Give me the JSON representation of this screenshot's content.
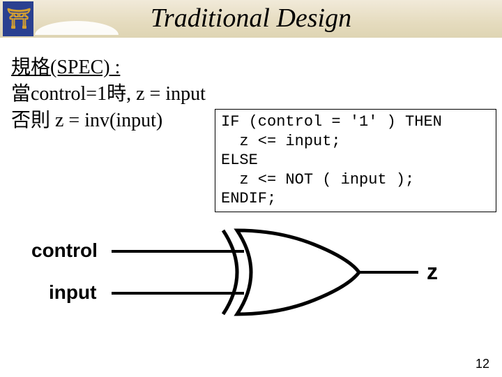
{
  "header": {
    "title": "Traditional Design"
  },
  "spec": {
    "heading": "規格(SPEC) :",
    "line1": "當control=1時, z = input",
    "line2": "否則 z = inv(input)"
  },
  "code": {
    "line1": "IF (control = '1' ) THEN",
    "line2": "  z <= input;",
    "line3": "ELSE",
    "line4": "  z <= NOT ( input );",
    "line5": "ENDIF;"
  },
  "diagram": {
    "label_control": "control",
    "label_input": "input",
    "label_output": "z"
  },
  "page_number": "12"
}
